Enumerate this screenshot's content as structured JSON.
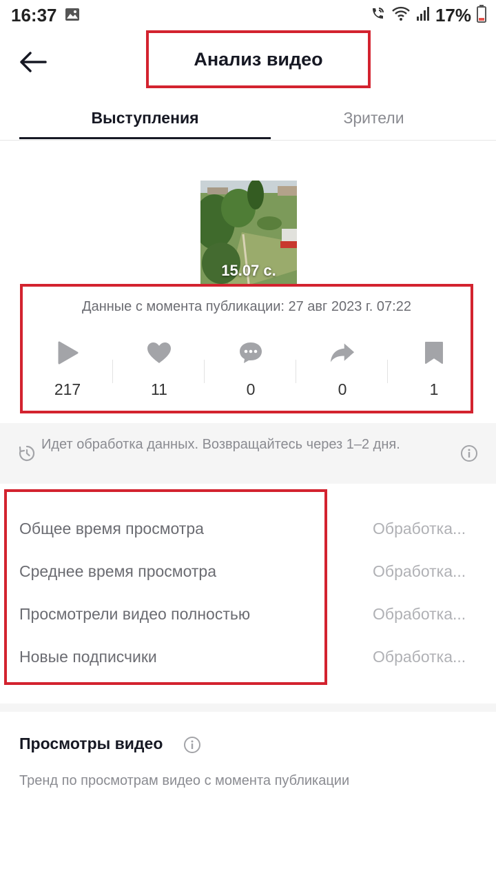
{
  "status_bar": {
    "time": "16:37",
    "battery": "17%",
    "icons": [
      "gallery-icon",
      "wifi-call-icon",
      "wifi-icon",
      "signal-icon",
      "battery-icon"
    ]
  },
  "header": {
    "title": "Анализ видео",
    "back_icon": "arrow-left-icon"
  },
  "tabs": [
    {
      "label": "Выступления",
      "active": true
    },
    {
      "label": "Зрители",
      "active": false
    }
  ],
  "video": {
    "duration": "15.07 с."
  },
  "stats": {
    "published": "Данные с момента публикации: 27 авг 2023 г. 07:22",
    "items": [
      {
        "icon": "play-icon",
        "value": "217"
      },
      {
        "icon": "heart-icon",
        "value": "11"
      },
      {
        "icon": "comment-icon",
        "value": "0"
      },
      {
        "icon": "share-icon",
        "value": "0"
      },
      {
        "icon": "bookmark-icon",
        "value": "1"
      }
    ]
  },
  "info_banner": {
    "text": "Идет обработка данных. Возвращайтесь через 1–2 дня."
  },
  "metrics": [
    {
      "label": "Общее время просмотра",
      "value": "Обработка..."
    },
    {
      "label": "Среднее время просмотра",
      "value": "Обработка..."
    },
    {
      "label": "Просмотрели видео полностью",
      "value": "Обработка..."
    },
    {
      "label": "Новые подписчики",
      "value": "Обработка..."
    }
  ],
  "video_views": {
    "title": "Просмотры видео",
    "subtitle": "Тренд по просмотрам видео с момента публикации"
  },
  "colors": {
    "highlight_border": "#d3232f",
    "text_primary": "#161823",
    "text_secondary": "#8a8b91",
    "icon_gray": "#a3a4a8"
  }
}
